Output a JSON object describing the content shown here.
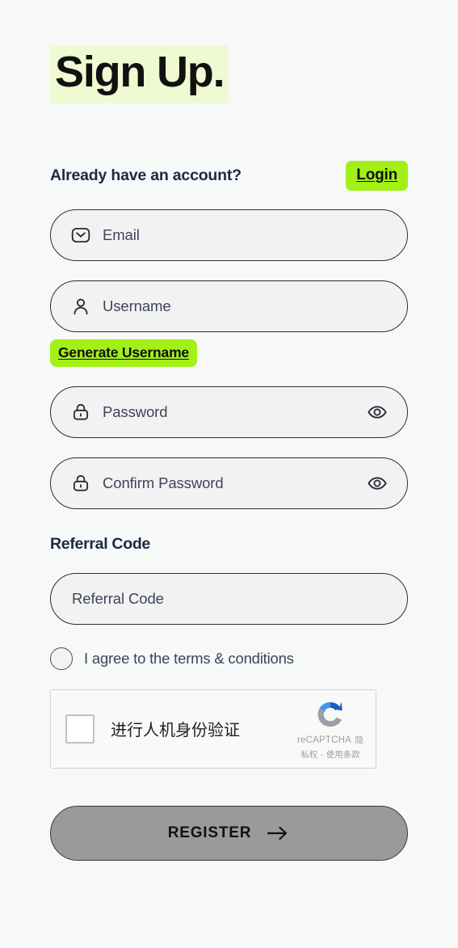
{
  "page": {
    "title": "Sign Up.",
    "background_color": "#f7f8f8",
    "accent_green": "#a3f017",
    "title_highlight": "#f0fad2"
  },
  "account_prompt": {
    "text": "Already have an account?",
    "login_label": "Login"
  },
  "fields": {
    "email": {
      "placeholder": "Email",
      "icon": "envelope-icon"
    },
    "username": {
      "placeholder": "Username",
      "icon": "user-icon"
    },
    "generate_username_label": "Generate Username",
    "password": {
      "placeholder": "Password",
      "icon": "lock-icon",
      "toggle_icon": "eye-icon"
    },
    "confirm_password": {
      "placeholder": "Confirm Password",
      "icon": "lock-icon",
      "toggle_icon": "eye-icon"
    },
    "referral": {
      "heading": "Referral Code",
      "placeholder": "Referral Code"
    }
  },
  "terms": {
    "label": "I agree to the terms & conditions",
    "checked": false
  },
  "recaptcha": {
    "checkbox_label": "进行人机身份验证",
    "brand": "reCAPTCHA",
    "links": "隐私权 - 使用条款",
    "checked": false
  },
  "submit": {
    "label": "REGISTER",
    "icon": "arrow-right-icon",
    "enabled": false,
    "color": "#9a9a9a"
  }
}
